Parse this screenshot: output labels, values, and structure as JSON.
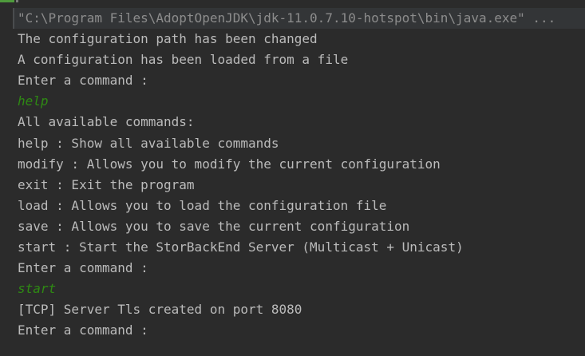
{
  "window": {
    "type": "run-console"
  },
  "colors": {
    "background": "#2b2b2b",
    "output_text": "#bbbbbb",
    "command_path_text": "#8c8c8c",
    "user_input_text": "#2e8a13"
  },
  "console": {
    "command_path": "\"C:\\Program Files\\AdoptOpenJDK\\jdk-11.0.7.10-hotspot\\bin\\java.exe\" ...",
    "lines": [
      {
        "kind": "output",
        "text": "The configuration path has been changed"
      },
      {
        "kind": "output",
        "text": "A configuration has been loaded from a file"
      },
      {
        "kind": "output",
        "text": "Enter a command :"
      },
      {
        "kind": "input",
        "text": "help"
      },
      {
        "kind": "output",
        "text": "All available commands:"
      },
      {
        "kind": "output",
        "text": "help : Show all available commands"
      },
      {
        "kind": "output",
        "text": "modify : Allows you to modify the current configuration"
      },
      {
        "kind": "output",
        "text": "exit : Exit the program"
      },
      {
        "kind": "output",
        "text": "load : Allows you to load the configuration file"
      },
      {
        "kind": "output",
        "text": "save : Allows you to save the current configuration"
      },
      {
        "kind": "output",
        "text": "start : Start the StorBackEnd Server (Multicast + Unicast)"
      },
      {
        "kind": "output",
        "text": "Enter a command :"
      },
      {
        "kind": "input",
        "text": "start"
      },
      {
        "kind": "output",
        "text": "[TCP] Server Tls created on port 8080"
      },
      {
        "kind": "output",
        "text": "Enter a command :"
      }
    ]
  }
}
